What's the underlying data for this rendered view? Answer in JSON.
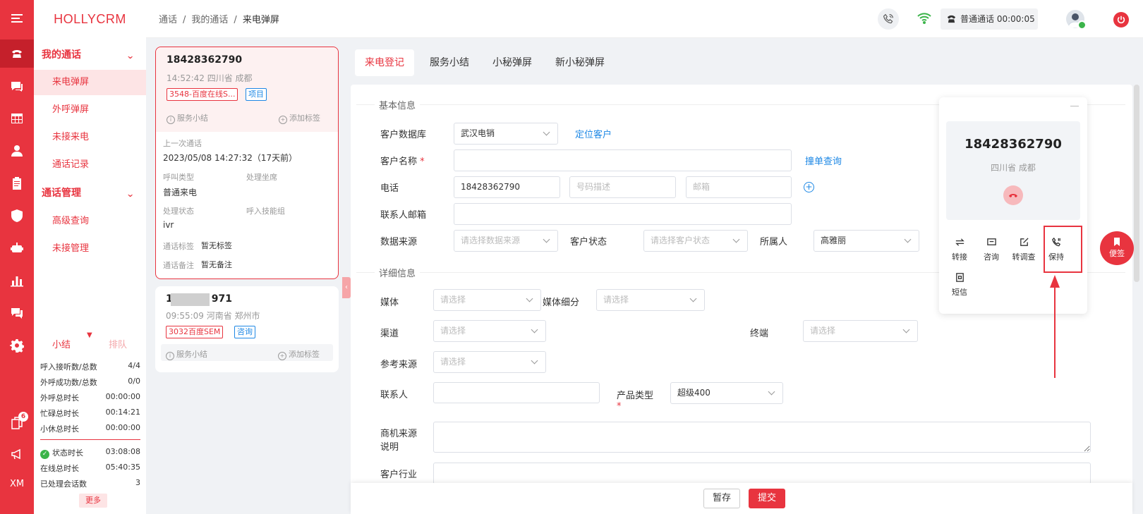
{
  "app": {
    "brand": "HOLLYCRM",
    "rail_initials": "XM",
    "rail_badge": "6"
  },
  "sidebar": {
    "groups": [
      {
        "label": "我的通话",
        "items": [
          "来电弹屏",
          "外呼弹屏",
          "未接来电",
          "通话记录"
        ]
      },
      {
        "label": "通话管理",
        "items": [
          "高级查询",
          "未接管理"
        ]
      }
    ],
    "active_item": "来电弹屏"
  },
  "stats": {
    "tab_summary": "小结",
    "tab_queue": "排队",
    "rows": [
      {
        "label": "呼入接听数/总数",
        "value": "4/4"
      },
      {
        "label": "外呼成功数/总数",
        "value": "0/0"
      },
      {
        "label": "外呼总时长",
        "value": "00:00:00"
      },
      {
        "label": "忙碌总时长",
        "value": "00:14:21"
      },
      {
        "label": "小休总时长",
        "value": "00:00:00"
      },
      {
        "label": "状态时长",
        "value": "03:08:08"
      },
      {
        "label": "在线总时长",
        "value": "05:40:35"
      },
      {
        "label": "已处理会话数",
        "value": "3"
      }
    ],
    "more": "更多"
  },
  "topbar": {
    "breadcrumb": [
      "通话",
      "我的通话",
      "来电弹屏"
    ],
    "call_status": "普通通话 00:00:05"
  },
  "calls": [
    {
      "number": "18428362790",
      "meta": "14:52:42 四川省 成都",
      "tags": [
        "3548-百度在线S...",
        "项目"
      ],
      "summary": "服务小结",
      "add_tag": "添加标签",
      "last_call_label": "上一次通话",
      "last_call": "2023/05/08 14:27:32（17天前）",
      "call_type_label": "呼叫类型",
      "call_type": "普通来电",
      "agent_label": "处理坐席",
      "status_label": "处理状态",
      "status": "ivr",
      "skill_group_label": "呼入技能组",
      "call_tag_label": "通话标签",
      "call_tag": "暂无标签",
      "call_note_label": "通话备注",
      "call_note": "暂无备注"
    },
    {
      "number_prefix": "1",
      "number_suffix": "971",
      "meta": "09:55:09 河南省 郑州市",
      "tags": [
        "3032百度SEM",
        "咨询"
      ],
      "summary": "服务小结",
      "add_tag": "添加标签"
    }
  ],
  "tabs": [
    "来电登记",
    "服务小结",
    "小秘弹屏",
    "新小秘弹屏"
  ],
  "form": {
    "section_basic": "基本信息",
    "section_detail": "详细信息",
    "customer_db_label": "客户数据库",
    "customer_db_value": "武汉电销",
    "locate_customer": "定位客户",
    "customer_name_label": "客户名称",
    "required_mark": "*",
    "dup_check": "撞单查询",
    "phone_label": "电话",
    "phone_value": "18428362790",
    "phone_desc_placeholder": "号码描述",
    "email_placeholder": "邮箱",
    "contact_email_label": "联系人邮箱",
    "data_source_label": "数据来源",
    "data_source_placeholder": "请选择数据来源",
    "customer_status_label": "客户状态",
    "customer_status_placeholder": "请选择客户状态",
    "owner_label": "所属人",
    "owner_value": "高雅丽",
    "media_label": "媒体",
    "media_sub_label": "媒体细分",
    "channel_label": "渠道",
    "terminal_label": "终端",
    "ref_source_label": "参考来源",
    "select_placeholder": "请选择",
    "contact_label": "联系人",
    "product_type_label": "产品类型",
    "product_type_value": "超级400",
    "opportunity_label_1": "商机来源",
    "opportunity_label_2": "说明",
    "industry_label": "客户行业"
  },
  "footer": {
    "save": "暂存",
    "submit": "提交"
  },
  "call_panel": {
    "number": "18428362790",
    "location": "四川省 成都",
    "actions": [
      "转接",
      "咨询",
      "转调查",
      "保持",
      "短信"
    ]
  },
  "floating": {
    "note": "便签"
  },
  "colors": {
    "brand": "#e8343f",
    "link": "#1e88e5",
    "online": "#3bb44a"
  }
}
